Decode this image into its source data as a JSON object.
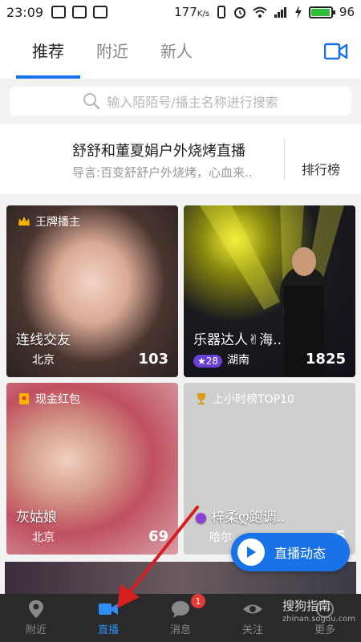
{
  "status_bar": {
    "time": "23:09",
    "speed": "177",
    "speed_unit": "K/s",
    "battery": "96",
    "battery_percent": 96
  },
  "tabs": [
    {
      "label": "推荐",
      "active": true
    },
    {
      "label": "附近",
      "active": false
    },
    {
      "label": "新人",
      "active": false
    }
  ],
  "search": {
    "placeholder": "输入陌陌号/播主名称进行搜索"
  },
  "broadcast": {
    "title": "舒舒和董夏娟户外烧烤直播",
    "subtitle": "导言:百变舒舒户外烧烤，心血来..",
    "rank_label": "排行榜"
  },
  "cards": [
    {
      "badge": "王牌播主",
      "title": "连线交友",
      "location": "北京",
      "count": "103",
      "badge_icon": "crown-icon"
    },
    {
      "badge": "",
      "title": "乐器达人✌海..",
      "location": "湖南",
      "count": "1825",
      "level": "28",
      "badge_icon": ""
    },
    {
      "badge": "现金红包",
      "title": "灰姑娘",
      "location": "北京",
      "count": "69",
      "badge_icon": "red-packet-icon"
    },
    {
      "badge": "上小时榜TOP10",
      "title": "梓柔ღ跑调..",
      "location": "哈尔",
      "count": "5",
      "badge_icon": "trophy-icon"
    }
  ],
  "fab": {
    "label": "直播动态"
  },
  "nav": [
    {
      "label": "附近",
      "icon": "location-pin-icon",
      "active": false
    },
    {
      "label": "直播",
      "icon": "video-camera-icon",
      "active": true
    },
    {
      "label": "消息",
      "icon": "chat-bubble-icon",
      "active": false,
      "badge": "1"
    },
    {
      "label": "关注",
      "icon": "eye-icon",
      "active": false
    },
    {
      "label": "更多",
      "icon": "more-icon",
      "active": false
    }
  ],
  "watermark": {
    "text": "搜狗指南",
    "sub": "zhinan.sogou.com"
  },
  "colors": {
    "accent": "#1a72e8",
    "nav_bg": "#2a2a2a",
    "badge_red": "#e53935"
  }
}
